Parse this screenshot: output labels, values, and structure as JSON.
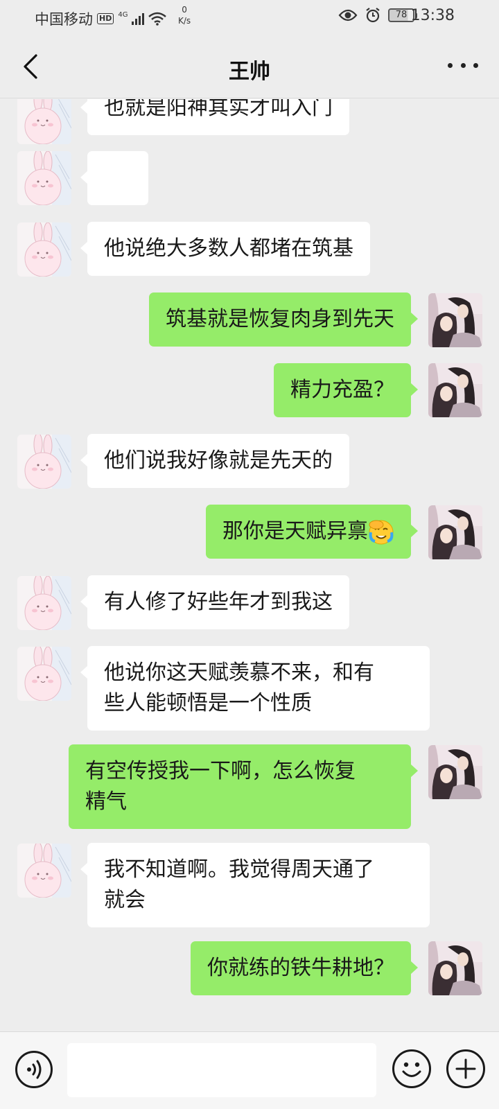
{
  "status_bar": {
    "carrier": "中国移动",
    "hd": "HD",
    "network": "4G",
    "speed_value": "0",
    "speed_unit": "K/s",
    "battery": "78",
    "time": "13:38"
  },
  "header": {
    "title": "王帅"
  },
  "messages": [
    {
      "side": "left",
      "text": "也就是阳神其实才叫入门"
    },
    {
      "side": "left",
      "text": "",
      "emoji": "facepalm-emoji"
    },
    {
      "side": "left",
      "text": "他说绝大多数人都堵在筑基"
    },
    {
      "side": "right",
      "text": "筑基就是恢复肉身到先天"
    },
    {
      "side": "right",
      "text": "精力充盈？"
    },
    {
      "side": "left",
      "text": "他们说我好像就是先天的"
    },
    {
      "side": "right",
      "text": "那你是天赋异禀",
      "emoji": "facepalm-emoji"
    },
    {
      "side": "left",
      "text": "有人修了好些年才到我这"
    },
    {
      "side": "left",
      "text": "他说你这天赋羡慕不来，和有\n些人能顿悟是一个性质"
    },
    {
      "side": "right",
      "text": "有空传授我一下啊，怎么恢复\n精气"
    },
    {
      "side": "left",
      "text": "我不知道啊。我觉得周天通了\n就会"
    },
    {
      "side": "right",
      "text": "你就练的铁牛耕地？"
    }
  ],
  "input_bar": {
    "placeholder": ""
  },
  "colors": {
    "background": "#ededed",
    "self_bubble": "#95ec69",
    "other_bubble": "#ffffff"
  }
}
